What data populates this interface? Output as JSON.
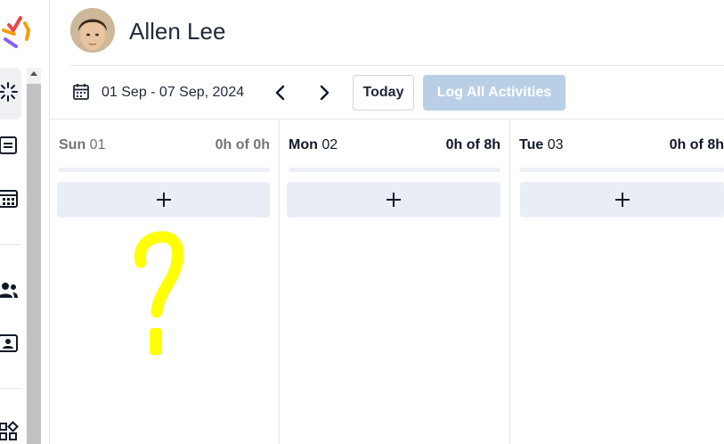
{
  "user": {
    "name": "Allen Lee"
  },
  "toolbar": {
    "date_range": "01 Sep - 07 Sep, 2024",
    "today_label": "Today",
    "log_all_label": "Log All Activities"
  },
  "days": [
    {
      "name": "Sun",
      "num": "01",
      "hours": "0h of 0h"
    },
    {
      "name": "Mon",
      "num": "02",
      "hours": "0h of 8h"
    },
    {
      "name": "Tue",
      "num": "03",
      "hours": "0h of 8h"
    }
  ],
  "add_label": "+",
  "icons": {
    "rail": [
      "app-logo-icon",
      "timesheet-icon",
      "list-icon",
      "calculator-icon",
      "team-icon",
      "contact-card-icon",
      "apps-grid-icon"
    ],
    "toolbar": [
      "calendar-icon",
      "chevron-left-icon",
      "chevron-right-icon"
    ]
  },
  "colors": {
    "log_all_button": "#b9cfe6",
    "add_button": "#e9eef6",
    "annotation": "#ffff00"
  }
}
